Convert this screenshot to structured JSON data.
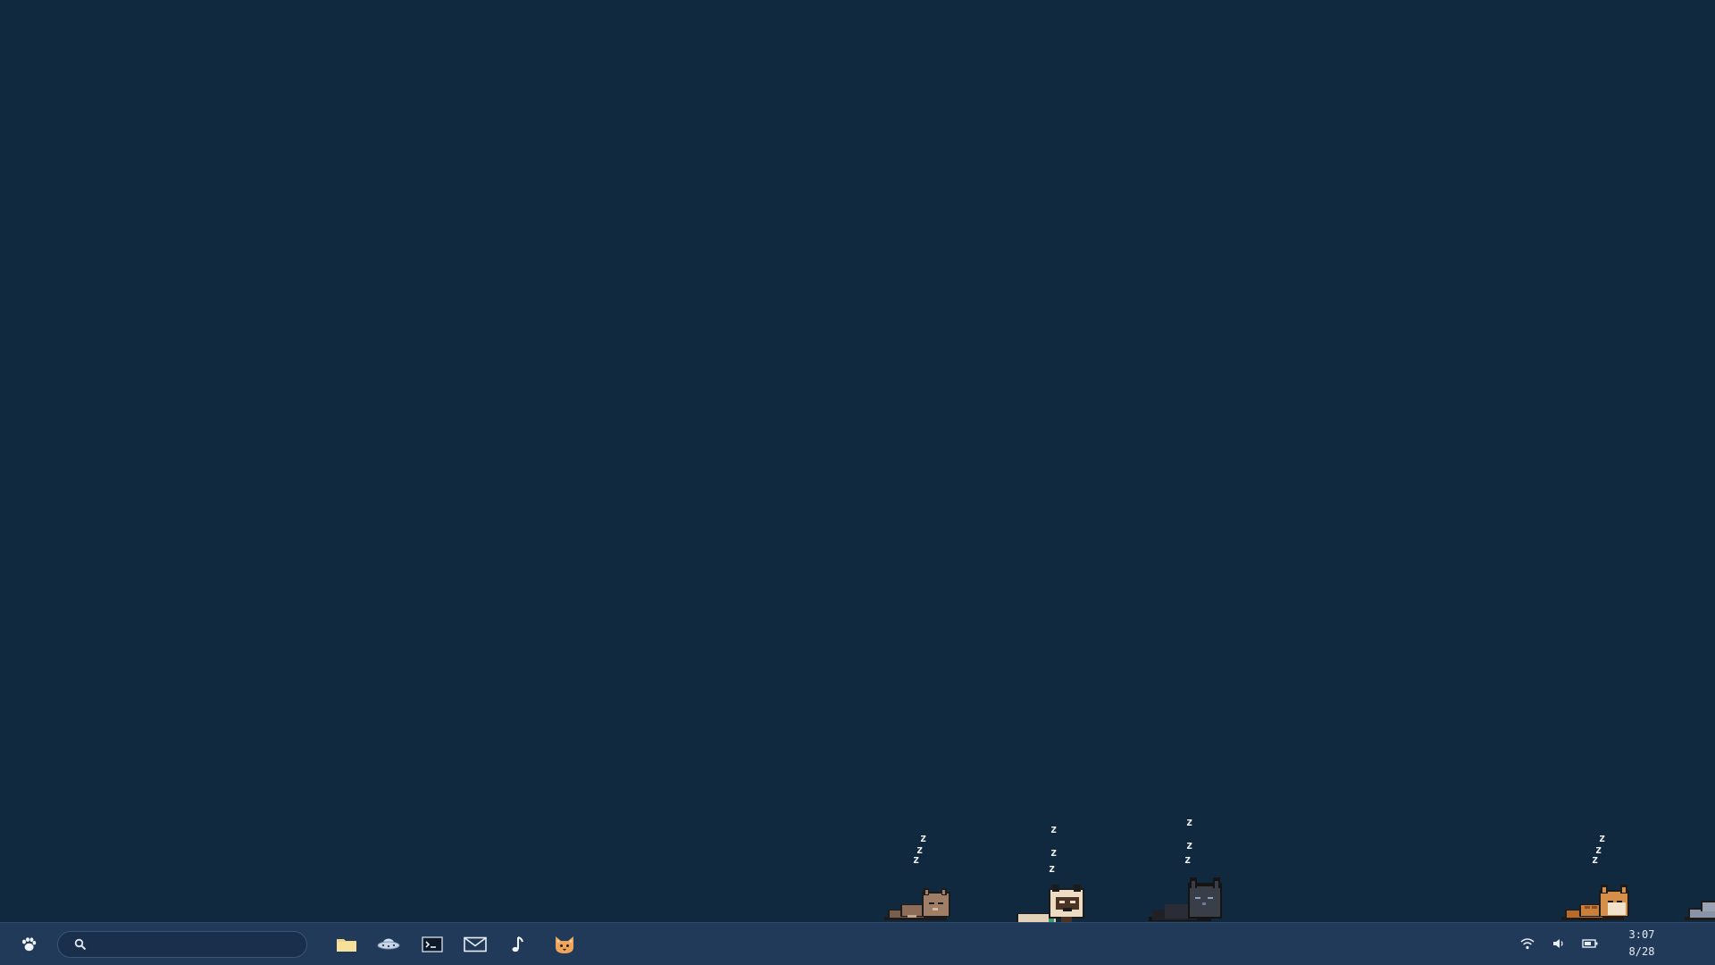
{
  "desktop": {
    "background_color": "#10293f"
  },
  "cats": [
    {
      "name": "brown-cat",
      "state": "sleeping",
      "zzz": [
        "z",
        "z",
        "z"
      ]
    },
    {
      "name": "siamese-cat",
      "state": "sleeping",
      "zzz": [
        "z",
        "z",
        "z"
      ]
    },
    {
      "name": "black-cat",
      "state": "sleeping",
      "zzz": [
        "z",
        "z",
        "z"
      ]
    },
    {
      "name": "orange-cat",
      "state": "sleeping",
      "zzz": [
        "z",
        "z",
        "z"
      ]
    },
    {
      "name": "gray-cat",
      "state": "partially-visible"
    }
  ],
  "taskbar": {
    "background_color": "#223a59",
    "start_button": {
      "icon": "paw-icon"
    },
    "search": {
      "placeholder": "",
      "value": "",
      "icon": "search-icon"
    },
    "pinned_apps": [
      {
        "name": "files",
        "icon": "folder-icon"
      },
      {
        "name": "browser",
        "icon": "ufo-icon"
      },
      {
        "name": "terminal",
        "icon": "terminal-icon"
      },
      {
        "name": "mail",
        "icon": "mail-icon"
      },
      {
        "name": "music",
        "icon": "music-note-icon"
      },
      {
        "name": "cat-app",
        "icon": "cat-face-icon"
      }
    ],
    "tray": [
      {
        "name": "wifi",
        "icon": "wifi-icon"
      },
      {
        "name": "volume",
        "icon": "volume-icon"
      },
      {
        "name": "battery",
        "icon": "battery-icon"
      }
    ],
    "clock": {
      "time": "3:07",
      "date": "8/28"
    }
  }
}
